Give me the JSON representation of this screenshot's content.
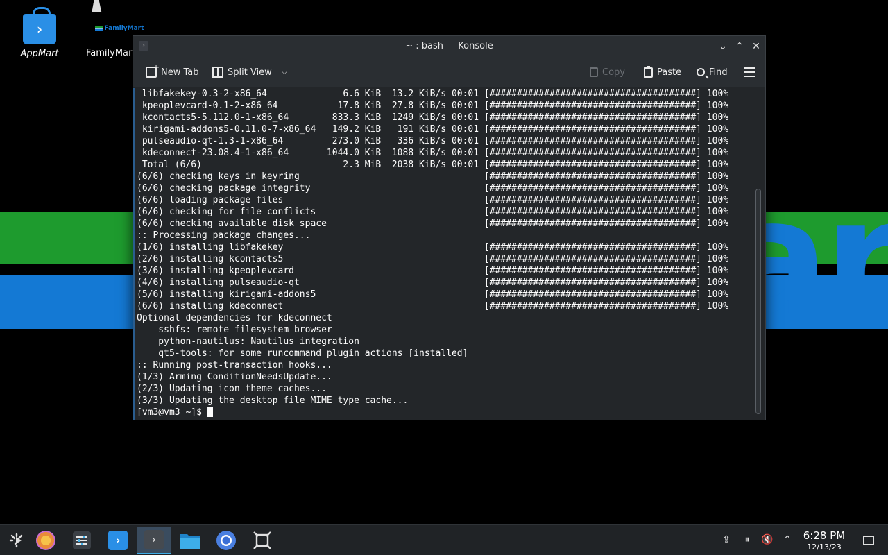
{
  "desktop": {
    "icons": [
      {
        "label": "AppMart",
        "icon": "shopping-bag-icon"
      },
      {
        "label": "FamilyMart",
        "logo_text": "FamilyMart"
      }
    ],
    "wallpaper_text": "art"
  },
  "window": {
    "title": "~ : bash — Konsole",
    "toolbar": {
      "new_tab": "New Tab",
      "split_view": "Split View",
      "copy": "Copy",
      "paste": "Paste",
      "find": "Find"
    },
    "terminal_lines": [
      " libfakekey-0.3-2-x86_64              6.6 KiB  13.2 KiB/s 00:01 [######################################] 100%",
      " kpeoplevcard-0.1-2-x86_64           17.8 KiB  27.8 KiB/s 00:01 [######################################] 100%",
      " kcontacts5-5.112.0-1-x86_64        833.3 KiB  1249 KiB/s 00:01 [######################################] 100%",
      " kirigami-addons5-0.11.0-7-x86_64   149.2 KiB   191 KiB/s 00:01 [######################################] 100%",
      " pulseaudio-qt-1.3-1-x86_64         273.0 KiB   336 KiB/s 00:01 [######################################] 100%",
      " kdeconnect-23.08.4-1-x86_64       1044.0 KiB  1088 KiB/s 00:01 [######################################] 100%",
      " Total (6/6)                          2.3 MiB  2038 KiB/s 00:01 [######################################] 100%",
      "(6/6) checking keys in keyring                                  [######################################] 100%",
      "(6/6) checking package integrity                                [######################################] 100%",
      "(6/6) loading package files                                     [######################################] 100%",
      "(6/6) checking for file conflicts                               [######################################] 100%",
      "(6/6) checking available disk space                             [######################################] 100%",
      ":: Processing package changes...",
      "(1/6) installing libfakekey                                     [######################################] 100%",
      "(2/6) installing kcontacts5                                     [######################################] 100%",
      "(3/6) installing kpeoplevcard                                   [######################################] 100%",
      "(4/6) installing pulseaudio-qt                                  [######################################] 100%",
      "(5/6) installing kirigami-addons5                               [######################################] 100%",
      "(6/6) installing kdeconnect                                     [######################################] 100%",
      "Optional dependencies for kdeconnect",
      "    sshfs: remote filesystem browser",
      "    python-nautilus: Nautilus integration",
      "    qt5-tools: for some runcommand plugin actions [installed]",
      ":: Running post-transaction hooks...",
      "(1/3) Arming ConditionNeedsUpdate...",
      "(2/3) Updating icon theme caches...",
      "(3/3) Updating the desktop file MIME type cache..."
    ],
    "prompt": "[vm3@vm3 ~]$ "
  },
  "taskbar": {
    "apps": [
      "application-launcher-icon",
      "pinwheel-app-icon",
      "settings-sliders-icon",
      "discover-store-icon",
      "konsole-icon",
      "file-manager-icon",
      "chromium-icon",
      "screenshot-tool-icon"
    ],
    "clock_time": "6:28 PM",
    "clock_date": "12/13/23"
  },
  "colors": {
    "terminal_bg": "#232629",
    "accent": "#3daee9",
    "wallpaper_green": "#1e9b2e",
    "wallpaper_blue": "#1479d4"
  }
}
